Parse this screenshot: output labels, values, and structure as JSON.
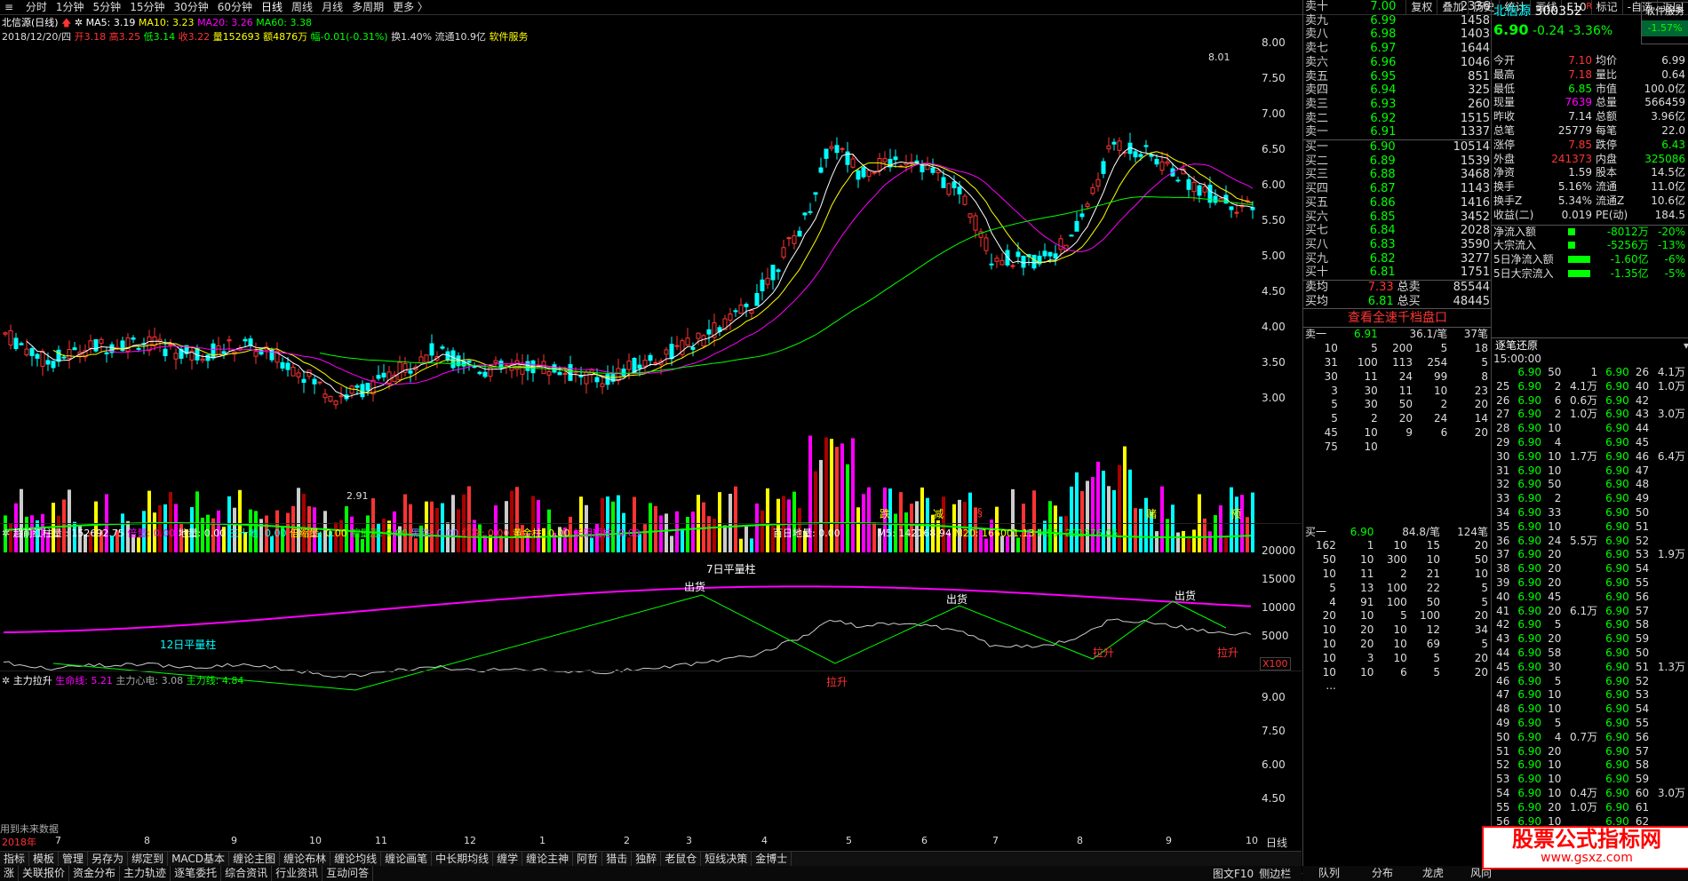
{
  "toolbar": {
    "periods": [
      "分时",
      "1分钟",
      "5分钟",
      "15分钟",
      "30分钟",
      "60分钟",
      "日线",
      "周线",
      "月线",
      "多周期",
      "更多 〉"
    ],
    "active": "日线",
    "right_tools": [
      "复权",
      "叠加",
      "历史",
      "统计",
      "画线",
      "F10",
      "标记",
      "-自选",
      "返回"
    ]
  },
  "chart_header": {
    "title": "北信源(日线)",
    "ma5": "MA5: 3.19",
    "ma10": "MA10: 3.23",
    "ma20": "MA20: 3.26",
    "ma60": "MA60: 3.38",
    "date": "2018/12/20/四",
    "open": "开3.18",
    "high": "高3.25",
    "low": "低3.14",
    "close": "收3.22",
    "vol": "量152693",
    "amount": "额4876万",
    "change": "幅-0.01(-0.31%)",
    "turnover": "换1.40%",
    "float": "流通10.9亿",
    "sector": "软件服务"
  },
  "price_axis": [
    "8.00",
    "7.50",
    "7.00",
    "6.50",
    "6.00",
    "5.50",
    "5.00",
    "4.50",
    "4.00",
    "3.50",
    "3.00"
  ],
  "price_labels": {
    "high": "8.01",
    "low": "2.91"
  },
  "event_marks": [
    "跌",
    "减",
    "§",
    "赌",
    "预"
  ],
  "vol_header": {
    "name": "超前红柱量",
    "value": ": 152692.75",
    "beiliang": "倍量: 0.00",
    "diliang": "地量: 0.00",
    "sanshi": "三十地: 0.00",
    "beisuo": "倍缩量: 0.00",
    "suozhang": "缩量涨: 0.00",
    "heidie": "黑跌: 0.00",
    "hongdie": "红跌: 0.00",
    "huangjin": "黄金柱: 0.00",
    "changyin": "长阴短柱: 0.00",
    "bairi": "百日地量: 0.00",
    "m5": "M5: 142168.94",
    "m20": "M20: 166001.13",
    "m55": "M55: 201376.06"
  },
  "vol_axis": [
    "20000",
    "15000",
    "10000",
    "5000"
  ],
  "vol_unit": "X100",
  "vol_labels": {
    "ping7": "7日平量柱",
    "ping12": "12日平量柱"
  },
  "ind_header": {
    "name": "主力拉升",
    "life": "生命线: 5.21",
    "heart": "主力心电: 3.08",
    "main": "主力线: 4.84"
  },
  "ind_axis": [
    "9.00",
    "7.50",
    "6.00",
    "4.50"
  ],
  "ind_labels": {
    "chu": "出货",
    "la": "拉升",
    "note": "用到未来数据"
  },
  "months": [
    "2018年",
    "7",
    "8",
    "9",
    "10",
    "11",
    "12",
    "1",
    "2",
    "3",
    "4",
    "5",
    "6",
    "7",
    "8",
    "9",
    "10"
  ],
  "period_label": "日线",
  "bottom_tabs": [
    "指标",
    "模板",
    "管理",
    "另存为",
    "绑定到",
    "MACD基本",
    "缠论主图",
    "缠论布林",
    "缠论均线",
    "缠论画笔",
    "中长期均线",
    "缠学",
    "缠论主神",
    "阿哲",
    "猎击",
    "独醉",
    "老鼠仓",
    "短线决策",
    "金博士"
  ],
  "bottom_tabs2": [
    "涨",
    "关联报价",
    "资金分布",
    "主力轨迹",
    "逐笔委托",
    "综合资讯",
    "行业资讯",
    "互动问答"
  ],
  "bottom_right": [
    "图文F10",
    "侧边栏",
    "《"
  ],
  "stock": {
    "name": "北信源",
    "code": "300352",
    "r": "R",
    "price": "6.90",
    "chg": "-0.24",
    "pct": "-3.36%",
    "service": "软件服务",
    "svc_pct": "-1.57%"
  },
  "asks": [
    [
      "卖十",
      "7.00",
      "2336"
    ],
    [
      "卖九",
      "6.99",
      "1458"
    ],
    [
      "卖八",
      "6.98",
      "1403"
    ],
    [
      "卖七",
      "6.97",
      "1644"
    ],
    [
      "卖六",
      "6.96",
      "1046"
    ],
    [
      "卖五",
      "6.95",
      "851"
    ],
    [
      "卖四",
      "6.94",
      "325"
    ],
    [
      "卖三",
      "6.93",
      "260"
    ],
    [
      "卖二",
      "6.92",
      "1515"
    ],
    [
      "卖一",
      "6.91",
      "1337"
    ]
  ],
  "bids": [
    [
      "买一",
      "6.90",
      "10514"
    ],
    [
      "买二",
      "6.89",
      "1539"
    ],
    [
      "买三",
      "6.88",
      "3468"
    ],
    [
      "买四",
      "6.87",
      "1143"
    ],
    [
      "买五",
      "6.86",
      "1416"
    ],
    [
      "买六",
      "6.85",
      "3452"
    ],
    [
      "买七",
      "6.84",
      "2028"
    ],
    [
      "买八",
      "6.83",
      "3590"
    ],
    [
      "买九",
      "6.82",
      "3277"
    ],
    [
      "买十",
      "6.81",
      "1751"
    ]
  ],
  "avg": [
    [
      "卖均",
      "7.33",
      "总卖",
      "85544"
    ],
    [
      "买均",
      "6.81",
      "总买",
      "48445"
    ]
  ],
  "view_full": "查看全速千档盘口",
  "ask_queue_head": [
    "卖一",
    "6.91",
    "36.1/笔",
    "37笔"
  ],
  "ask_queue": [
    [
      "10",
      "5",
      "200",
      "5",
      "18"
    ],
    [
      "31",
      "100",
      "113",
      "254",
      "5"
    ],
    [
      "30",
      "11",
      "24",
      "99",
      "8"
    ],
    [
      "3",
      "30",
      "11",
      "10",
      "23"
    ],
    [
      "5",
      "30",
      "50",
      "2",
      "20"
    ],
    [
      "5",
      "2",
      "20",
      "24",
      "14"
    ],
    [
      "45",
      "10",
      "9",
      "6",
      "20"
    ],
    [
      "75",
      "10",
      "",
      "",
      ""
    ]
  ],
  "bid_queue_head": [
    "买一",
    "6.90",
    "84.8/笔",
    "124笔"
  ],
  "bid_queue": [
    [
      "162",
      "1",
      "10",
      "15",
      "20"
    ],
    [
      "50",
      "10",
      "300",
      "10",
      "50"
    ],
    [
      "10",
      "11",
      "2",
      "21",
      "10"
    ],
    [
      "5",
      "13",
      "100",
      "22",
      "5"
    ],
    [
      "4",
      "91",
      "100",
      "50",
      "5"
    ],
    [
      "20",
      "10",
      "5",
      "100",
      "20"
    ],
    [
      "10",
      "20",
      "10",
      "12",
      "34"
    ],
    [
      "10",
      "20",
      "10",
      "69",
      "5"
    ],
    [
      "10",
      "3",
      "10",
      "5",
      "20"
    ],
    [
      "10",
      "10",
      "6",
      "5",
      "20"
    ],
    [
      "...",
      "",
      "",
      "",
      ""
    ]
  ],
  "quote": [
    [
      "今开",
      "7.10",
      "均价",
      "6.99"
    ],
    [
      "最高",
      "7.18",
      "量比",
      "0.64"
    ],
    [
      "最低",
      "6.85",
      "市值",
      "100.0亿"
    ],
    [
      "现量",
      "7639",
      "总量",
      "566459"
    ],
    [
      "昨收",
      "7.14",
      "总额",
      "3.96亿"
    ],
    [
      "总笔",
      "25779",
      "每笔",
      "22.0"
    ],
    [
      "涨停",
      "7.85",
      "跌停",
      "6.43"
    ],
    [
      "外盘",
      "241373",
      "内盘",
      "325086"
    ],
    [
      "净资",
      "1.59",
      "股本",
      "14.5亿"
    ],
    [
      "换手",
      "5.16%",
      "流通",
      "11.0亿"
    ],
    [
      "换手Z",
      "5.34%",
      "流通Z",
      "10.6亿"
    ],
    [
      "收益(二)",
      "0.019",
      "PE(动)",
      "184.5"
    ]
  ],
  "flows": [
    [
      "净流入额",
      "-8012万",
      "-20%"
    ],
    [
      "大宗流入",
      "-5256万",
      "-13%"
    ],
    [
      "5日净流入额",
      "-1.60亿",
      "-6%"
    ],
    [
      "5日大宗流入",
      "-1.35亿",
      "-5%"
    ]
  ],
  "tape_title": "逐笔还原",
  "tape_time": "15:00:00",
  "tape": [
    [
      "",
      "6.90",
      "50",
      "1",
      "6.90",
      "26"
    ],
    [
      "25",
      "6.90",
      "2",
      "4.1万",
      "6.90",
      "40"
    ],
    [
      "26",
      "6.90",
      "6",
      "0.6万",
      "6.90",
      "42"
    ],
    [
      "27",
      "6.90",
      "2",
      "1.0万",
      "6.90",
      "43"
    ],
    [
      "28",
      "6.90",
      "10",
      "",
      "6.90",
      "44"
    ],
    [
      "29",
      "6.90",
      "4",
      "",
      "6.90",
      "45"
    ],
    [
      "30",
      "6.90",
      "10",
      "1.7万",
      "6.90",
      "46"
    ],
    [
      "31",
      "6.90",
      "10",
      "",
      "6.90",
      "47"
    ],
    [
      "32",
      "6.90",
      "50",
      "",
      "6.90",
      "48"
    ],
    [
      "33",
      "6.90",
      "2",
      "",
      "6.90",
      "49"
    ],
    [
      "34",
      "6.90",
      "33",
      "",
      "6.90",
      "50"
    ],
    [
      "35",
      "6.90",
      "10",
      "",
      "6.90",
      "51"
    ],
    [
      "36",
      "6.90",
      "24",
      "5.5万",
      "6.90",
      "52"
    ],
    [
      "37",
      "6.90",
      "20",
      "",
      "6.90",
      "53"
    ],
    [
      "38",
      "6.90",
      "20",
      "",
      "6.90",
      "54"
    ],
    [
      "39",
      "6.90",
      "20",
      "",
      "6.90",
      "55"
    ],
    [
      "40",
      "6.90",
      "45",
      "",
      "6.90",
      "56"
    ],
    [
      "41",
      "6.90",
      "20",
      "6.1万",
      "6.90",
      "57"
    ],
    [
      "42",
      "6.90",
      "5",
      "",
      "6.90",
      "58"
    ],
    [
      "43",
      "6.90",
      "20",
      "",
      "6.90",
      "59"
    ],
    [
      "44",
      "6.90",
      "58",
      "",
      "6.90",
      "50"
    ],
    [
      "45",
      "6.90",
      "30",
      "",
      "6.90",
      "51"
    ],
    [
      "46",
      "6.90",
      "5",
      "",
      "6.90",
      "52"
    ],
    [
      "47",
      "6.90",
      "10",
      "",
      "6.90",
      "53"
    ],
    [
      "48",
      "6.90",
      "10",
      "",
      "6.90",
      "54"
    ],
    [
      "49",
      "6.90",
      "5",
      "",
      "6.90",
      "55"
    ],
    [
      "50",
      "6.90",
      "4",
      "0.7万",
      "6.90",
      "56"
    ],
    [
      "51",
      "6.90",
      "20",
      "",
      "6.90",
      "57"
    ],
    [
      "52",
      "6.90",
      "10",
      "",
      "6.90",
      "58"
    ],
    [
      "53",
      "6.90",
      "10",
      "",
      "6.90",
      "59"
    ],
    [
      "54",
      "6.90",
      "10",
      "0.4万",
      "6.90",
      "60"
    ],
    [
      "55",
      "6.90",
      "20",
      "1.0万",
      "6.90",
      "61"
    ],
    [
      "56",
      "6.90",
      "10",
      "",
      "6.90",
      "62"
    ],
    [
      "57",
      "6.90",
      "3",
      "",
      "6.90",
      "63"
    ],
    [
      "58",
      "6.90",
      "10",
      "",
      "6.90",
      "64"
    ]
  ],
  "tape_right": [
    "4.1万",
    "1.0万",
    "",
    "3.0万",
    "",
    "",
    "6.4万",
    "",
    "",
    "",
    "",
    "",
    "",
    "1.9万",
    "",
    "",
    "",
    "",
    "",
    "",
    "",
    "1.3万",
    "",
    "",
    "",
    "",
    "",
    "",
    "",
    "",
    "3.0万",
    "",
    "",
    "1.0万",
    ""
  ],
  "right_bottom_tabs": [
    "队列",
    "分布",
    "龙虎",
    "风向"
  ],
  "watermark": {
    "line1": "股票公式指标网",
    "line2": "www.gsxz.com"
  }
}
